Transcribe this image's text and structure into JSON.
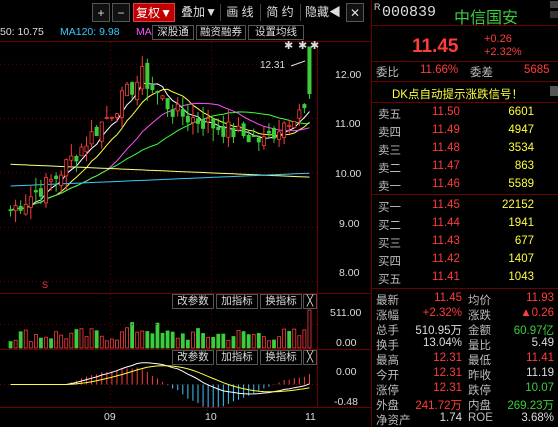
{
  "toolbar": {
    "plus": "+",
    "minus": "−",
    "fuquan": "复权",
    "fuquan_arrow": "▼",
    "diejia": "叠加",
    "diejia_arrow": "▼",
    "huaxian": "画 线",
    "jianyue": "简 约",
    "yincang": "隐藏",
    "yincang_arrow": "◀",
    "close": "✕"
  },
  "info": {
    "ma_prefix": "50: 10.75",
    "ma120": "MA120: 9.98",
    "ma_tail": "MA"
  },
  "subtabs": {
    "shenggutong": "深股通",
    "rongzirongquan": "融资融券",
    "setma": "设置均线"
  },
  "kline": {
    "peak_label": "12.31",
    "y_ticks": [
      "12.00",
      "11.00",
      "10.00",
      "9.00",
      "8.00"
    ],
    "marker": "S"
  },
  "volume_panel": {
    "btn_param": "改参数",
    "btn_add": "加指标",
    "btn_switch": "换指标",
    "btn_close": "╳",
    "y_ticks": [
      "511.00",
      "0.00"
    ]
  },
  "indicator_panel": {
    "btn_param": "改参数",
    "btn_add": "加指标",
    "btn_switch": "换指标",
    "btn_close": "╳",
    "y_ticks": [
      "0.00",
      "-0.48"
    ]
  },
  "x_axis": [
    "09",
    "10",
    "11"
  ],
  "quote": {
    "code": "000839",
    "r_mark": "R",
    "name": "中信国安",
    "price": "11.45",
    "change": "+0.26",
    "change_pct": "+2.32%",
    "weibi_label": "委比",
    "weibi_value": "11.66%",
    "weicha_label": "委差",
    "weicha_value": "5685",
    "dk_signal": "DK点自动提示涨跌信号！",
    "asks": [
      {
        "label": "卖五",
        "price": "11.50",
        "vol": "6601"
      },
      {
        "label": "卖四",
        "price": "11.49",
        "vol": "4947"
      },
      {
        "label": "卖三",
        "price": "11.48",
        "vol": "3534"
      },
      {
        "label": "卖二",
        "price": "11.47",
        "vol": "863"
      },
      {
        "label": "卖一",
        "price": "11.46",
        "vol": "5589"
      }
    ],
    "bids": [
      {
        "label": "买一",
        "price": "11.45",
        "vol": "22152"
      },
      {
        "label": "买二",
        "price": "11.44",
        "vol": "1941"
      },
      {
        "label": "买三",
        "price": "11.43",
        "vol": "677"
      },
      {
        "label": "买四",
        "price": "11.42",
        "vol": "1407"
      },
      {
        "label": "买五",
        "price": "11.41",
        "vol": "1043"
      }
    ],
    "stats": [
      {
        "l1": "最新",
        "v1": "11.45",
        "c1": "red",
        "l2": "均价",
        "v2": "11.93",
        "c2": "red"
      },
      {
        "l1": "涨幅",
        "v1": "+2.32%",
        "c1": "red",
        "l2": "涨跌",
        "v2": "▲0.26",
        "c2": "red"
      },
      {
        "l1": "总手",
        "v1": "510.95万",
        "c1": "white",
        "l2": "金额",
        "v2": "60.97亿",
        "c2": "green"
      },
      {
        "l1": "换手",
        "v1": "13.04%",
        "c1": "white",
        "l2": "量比",
        "v2": "5.49",
        "c2": "white"
      },
      {
        "l1": "最高",
        "v1": "12.31",
        "c1": "red",
        "l2": "最低",
        "v2": "11.41",
        "c2": "red"
      },
      {
        "l1": "今开",
        "v1": "12.31",
        "c1": "red",
        "l2": "昨收",
        "v2": "11.19",
        "c2": "white"
      },
      {
        "l1": "涨停",
        "v1": "12.31",
        "c1": "red",
        "l2": "跌停",
        "v2": "10.07",
        "c2": "green"
      },
      {
        "l1": "外盘",
        "v1": "241.72万",
        "c1": "red",
        "l2": "内盘",
        "v2": "269.23万",
        "c2": "green"
      },
      {
        "l1": "净资产",
        "v1": "1.74",
        "c1": "white",
        "l2": "ROE",
        "v2": "3.68%",
        "c2": "white"
      }
    ]
  },
  "colors": {
    "up": "#ff3c3c",
    "down": "#3ccd3c",
    "border": "#6b0000",
    "ma_yellow": "#ffff3c",
    "ma_magenta": "#ff50ff",
    "ma_cyan": "#3cc8ff"
  },
  "chart_data": {
    "type": "candlestick",
    "title": "",
    "ylim": [
      7.8,
      12.4
    ],
    "x_ticks": [
      "09",
      "10",
      "11"
    ],
    "last": 11.45,
    "high": 12.31
  }
}
